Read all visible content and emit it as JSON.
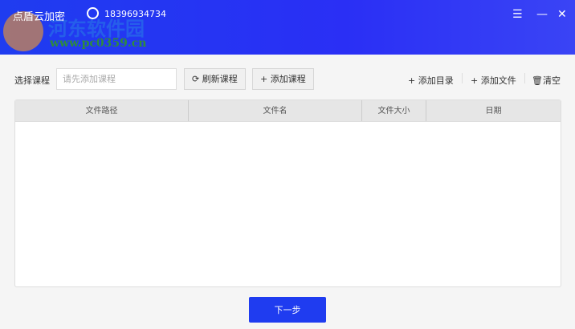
{
  "header": {
    "title": "点盾云加密",
    "phone": "18396934734",
    "watermark": "河东软件园",
    "watermark_url": "www.pc0359.cn"
  },
  "toolbar": {
    "course_label": "选择课程",
    "course_placeholder": "请先添加课程",
    "refresh": "刷新课程",
    "add_course": "+ 添加课程",
    "add_dir": "+ 添加目录",
    "add_file": "+ 添加文件",
    "clear": "清空"
  },
  "table": {
    "columns": [
      "文件路径",
      "文件名",
      "文件大小",
      "日期"
    ],
    "rows": []
  },
  "footer": {
    "next": "下一步"
  }
}
